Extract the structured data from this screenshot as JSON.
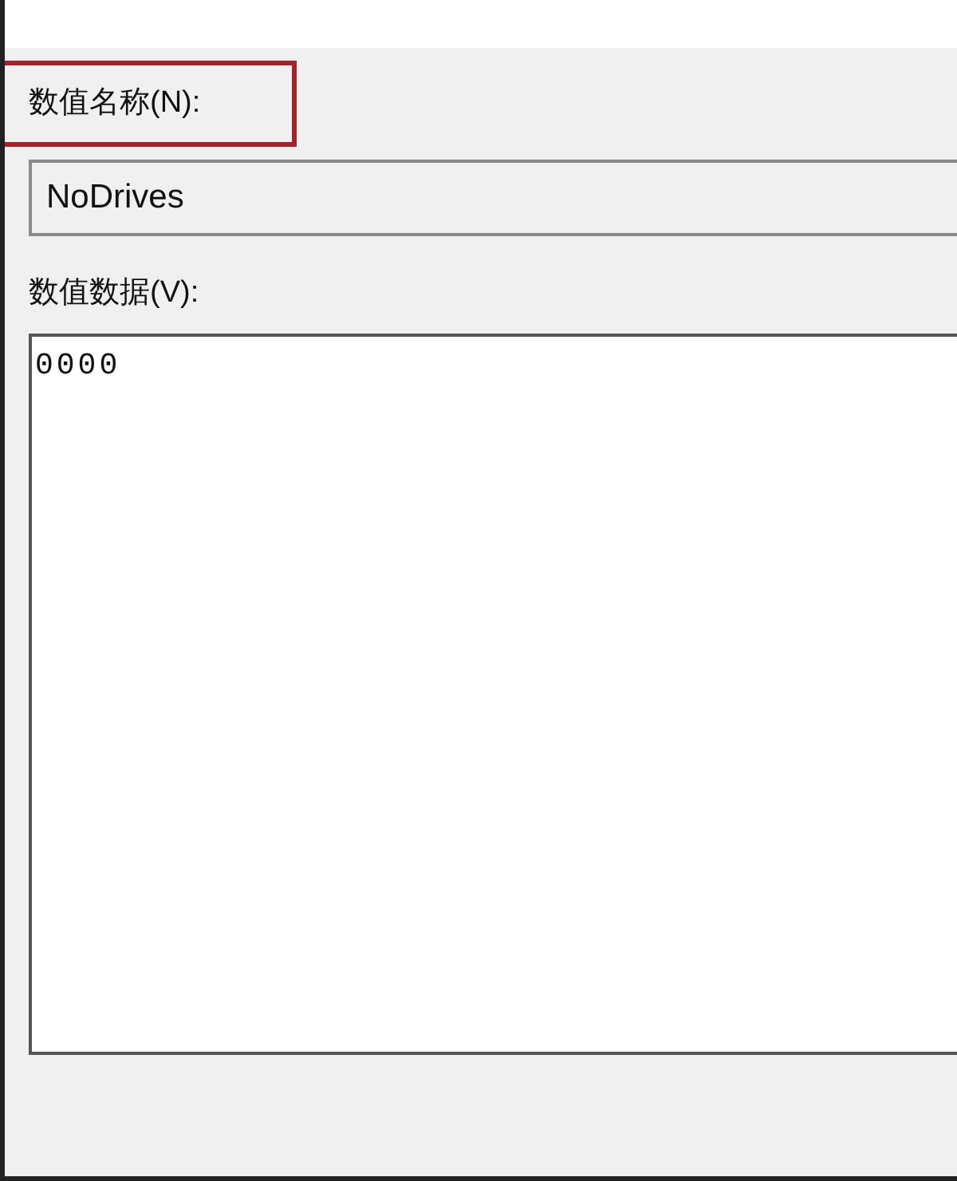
{
  "value_name": {
    "label": "数值名称(N):",
    "highlighted": true,
    "value": "NoDrives"
  },
  "value_data": {
    "label": "数值数据(V):",
    "value": "0000"
  }
}
